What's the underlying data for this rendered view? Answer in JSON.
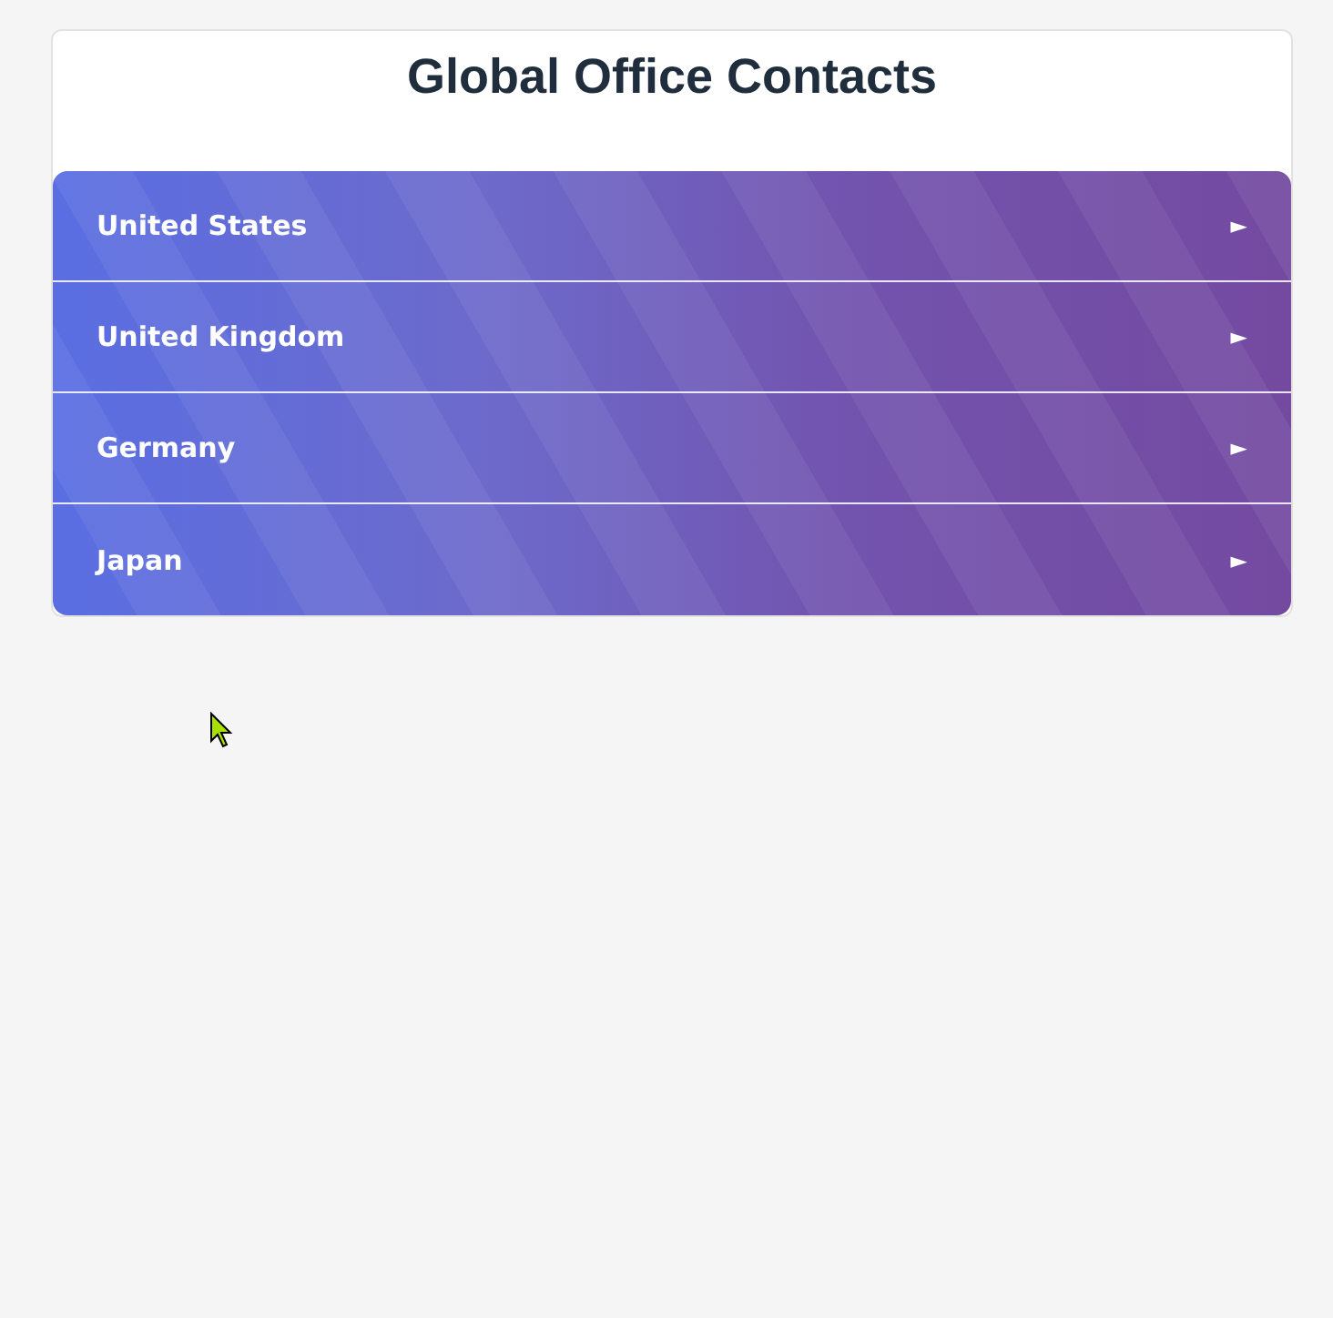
{
  "title": "Global Office Contacts",
  "countries": [
    {
      "name": "United States",
      "arrow": "►",
      "expanded": false
    },
    {
      "name": "United Kingdom",
      "arrow": "►",
      "expanded": false
    },
    {
      "name": "Germany",
      "arrow": "►",
      "expanded": false
    },
    {
      "name": "Japan",
      "arrow": "►",
      "expanded": false
    }
  ]
}
